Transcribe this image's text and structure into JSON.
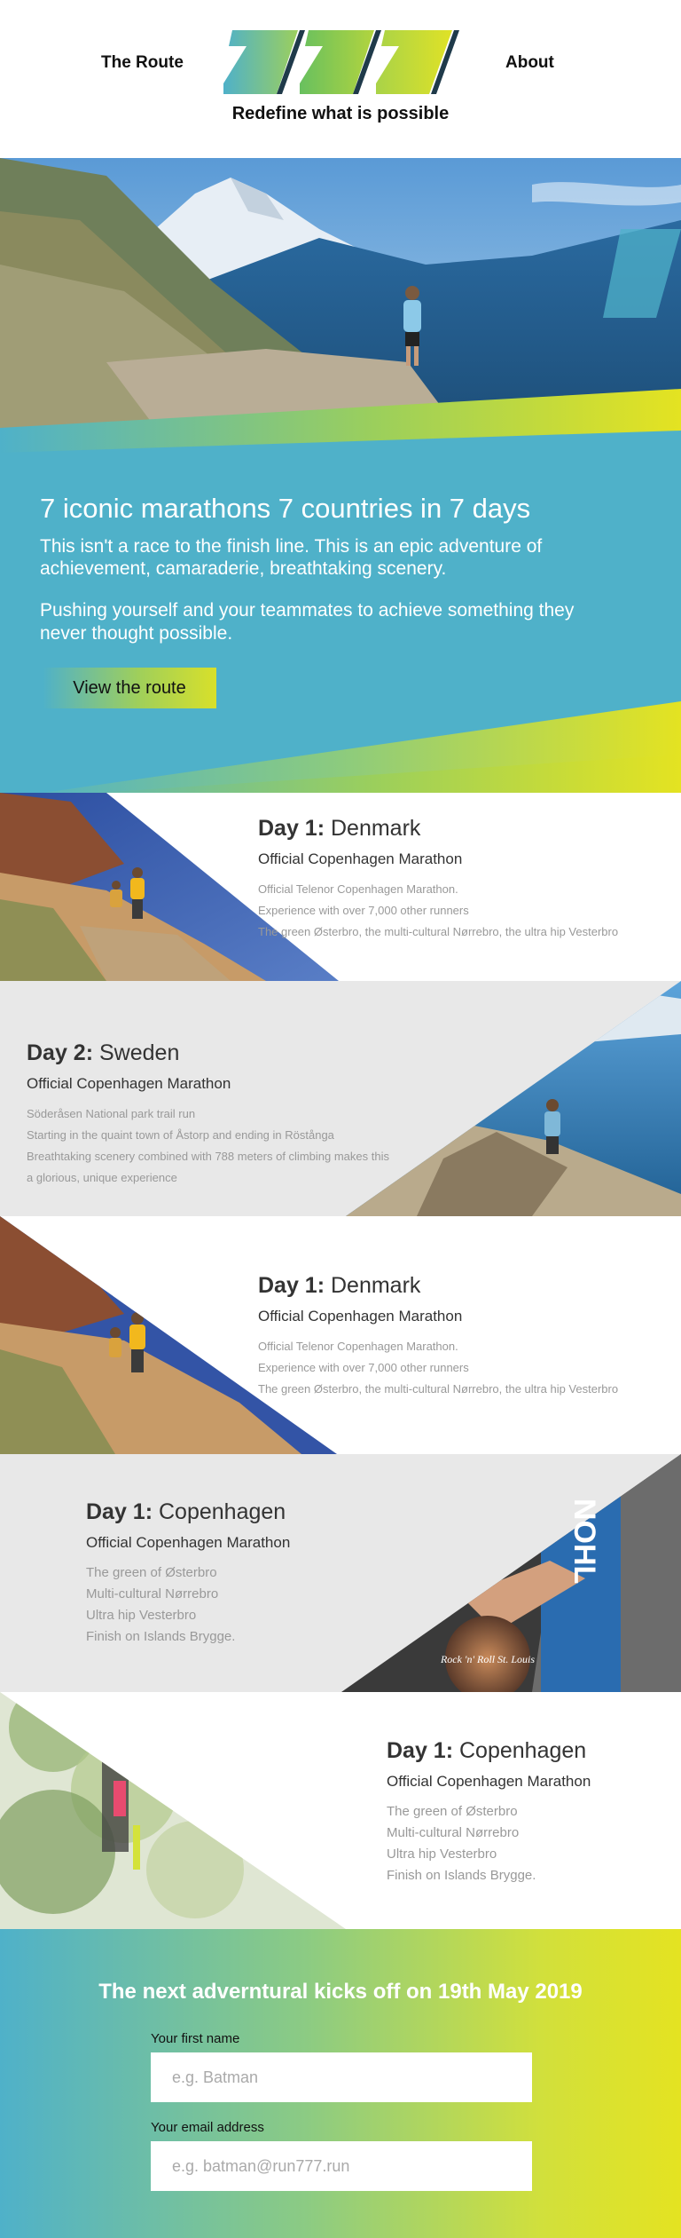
{
  "nav": {
    "route_label": "The Route",
    "about_label": "About",
    "tagline": "Redefine what is possible"
  },
  "intro": {
    "title": "7 iconic marathons 7 countries in 7 days",
    "p1": "This isn't a race to the finish line. This is an epic adventure of achievement, camaraderie, breathtaking scenery.",
    "p2": "Pushing yourself and your teammates to achieve something they never thought possible.",
    "button_label": "View the route"
  },
  "days": [
    {
      "day": "Day 1:",
      "place": "Denmark",
      "subtitle": "Official Copenhagen Marathon",
      "lines": [
        "Official Telenor Copenhagen Marathon.",
        "Experience with over 7,000 other runners",
        "The green Østerbro, the multi-cultural Nørrebro, the ultra hip Vesterbro"
      ]
    },
    {
      "day": "Day 2:",
      "place": "Sweden",
      "subtitle": "Official Copenhagen Marathon",
      "lines": [
        "Söderåsen National park trail run",
        "Starting in the quaint town of Åstorp and ending in Röstånga",
        "Breathtaking scenery combined with 788 meters of climbing makes this",
        "a glorious, unique experience"
      ]
    },
    {
      "day": "Day 1:",
      "place": "Denmark",
      "subtitle": "Official Copenhagen Marathon",
      "lines": [
        "Official Telenor Copenhagen Marathon.",
        "Experience with over 7,000 other runners",
        "The green Østerbro, the multi-cultural Nørrebro, the ultra hip Vesterbro"
      ]
    },
    {
      "day": "Day 1:",
      "place": "Copenhagen",
      "subtitle": "Official Copenhagen Marathon",
      "lines": [
        "The green of Østerbro",
        "Multi-cultural Nørrebro",
        "Ultra hip Vesterbro",
        "Finish on Islands Brygge."
      ]
    },
    {
      "day": "Day 1:",
      "place": "Copenhagen",
      "subtitle": "Official Copenhagen Marathon",
      "lines": [
        "The green of Østerbro",
        "Multi-cultural Nørrebro",
        "Ultra hip Vesterbro",
        "Finish on Islands Brygge."
      ]
    }
  ],
  "medal": {
    "ribbon_text": "NOHL",
    "medal_text": "Rock 'n' Roll St. Louis"
  },
  "signup": {
    "title": "The next adverntural kicks off on 19th May 2019",
    "first_name_label": "Your first name",
    "first_name_placeholder": "e.g. Batman",
    "email_label": "Your email address",
    "email_placeholder": "e.g. batman@run777.run"
  },
  "colors": {
    "blue": "#4fb1c9",
    "green": "#6cc35a",
    "yellow": "#e4e321",
    "grey_section": "#e8e8e8"
  }
}
